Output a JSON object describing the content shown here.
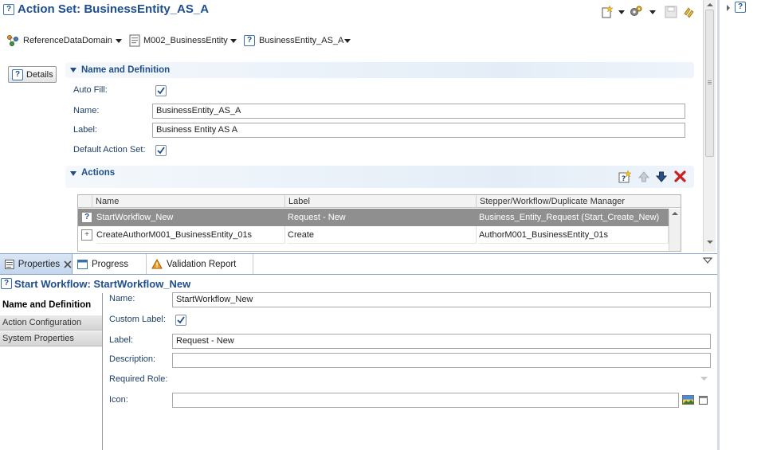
{
  "editor": {
    "title": "Action Set: BusinessEntity_AS_A",
    "breadcrumbs": [
      {
        "label": "ReferenceDataDomain",
        "icon": "domain-icon"
      },
      {
        "label": "M002_BusinessEntity",
        "icon": "model-icon"
      },
      {
        "label": "BusinessEntity_AS_A",
        "icon": "action-set-icon"
      }
    ],
    "details_label": "Details",
    "name_def": {
      "title": "Name and Definition",
      "auto_fill_label": "Auto Fill:",
      "auto_fill_checked": true,
      "name_label": "Name:",
      "name_value": "BusinessEntity_AS_A",
      "label_label": "Label:",
      "label_value": "Business Entity AS A",
      "default_label": "Default Action Set:",
      "default_checked": true
    },
    "actions": {
      "title": "Actions",
      "columns": [
        "Name",
        "Label",
        "Stepper/Workflow/Duplicate Manager"
      ],
      "rows": [
        {
          "name": "StartWorkflow_New",
          "label": "Request - New",
          "target": "Business_Entity_Request (Start_Create_New)",
          "selected": true
        },
        {
          "name": "CreateAuthorM001_BusinessEntity_01s",
          "label": "Create",
          "target": "AuthorM001_BusinessEntity_01s",
          "selected": false
        }
      ]
    }
  },
  "properties": {
    "tabs": [
      {
        "label": "Properties",
        "active": true
      },
      {
        "label": "Progress",
        "active": false
      },
      {
        "label": "Validation Report",
        "active": false
      }
    ],
    "title": "Start Workflow: StartWorkflow_New",
    "side_tabs": [
      "Name and Definition",
      "Action Configuration",
      "System Properties"
    ],
    "form": {
      "name_label": "Name:",
      "name_value": "StartWorkflow_New",
      "custom_label_label": "Custom Label:",
      "custom_label_checked": true,
      "label_label": "Label:",
      "label_value": "Request - New",
      "description_label": "Description:",
      "description_value": "",
      "role_label": "Required Role:",
      "icon_label": "Icon:",
      "icon_value": ""
    }
  },
  "colors": {
    "title_blue": "#1f4e8c",
    "selection_gray": "#8f8f8f",
    "annotation_red": "#e02020",
    "delete_red": "#cc1f1f"
  }
}
